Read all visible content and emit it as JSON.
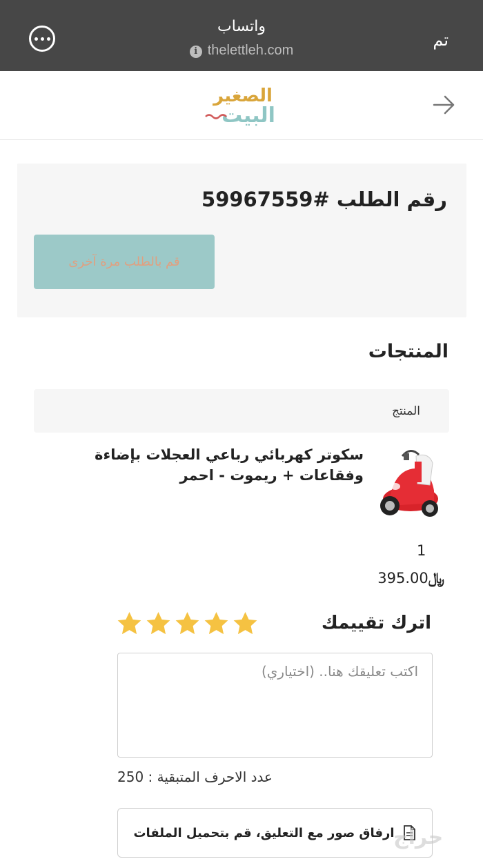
{
  "topbar": {
    "title": "واتساب",
    "url": "thelettleh.com",
    "done_label": "تم"
  },
  "logo": {
    "line1": "الصغير",
    "line2": "البيت"
  },
  "order": {
    "title": "رقم الطلب #59967559",
    "reorder_label": "قم بالطلب مرة آخرى"
  },
  "products": {
    "section_title": "المنتجات",
    "column_header": "المنتج",
    "item": {
      "name": "سكوتر كهربائي رباعي العجلات بإضاءة وفقاعات + ريموت - احمر",
      "quantity": "1",
      "price": "395.00",
      "currency": "﷼"
    }
  },
  "review": {
    "title": "اترك تقييمك",
    "stars": 5,
    "star_color": "#f5c242",
    "comment_placeholder": "اكتب تعليقك هنا.. (اختياري)",
    "remaining_label": "عدد الاحرف المتبقية :",
    "remaining_count": "250",
    "attach_label": "ارفاق صور مع التعليق، قم بتحميل الملفات"
  },
  "watermark": "حراج"
}
